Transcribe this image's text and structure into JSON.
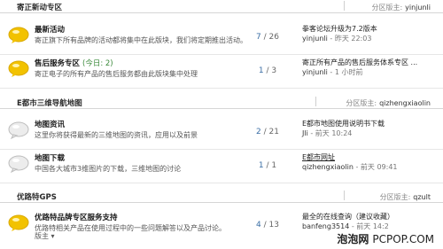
{
  "sections": [
    {
      "title": "寄正新动专区",
      "moderator_label": "分区版主:",
      "moderator": "yinjunli",
      "forums": [
        {
          "name": "最新活动",
          "today": "",
          "description": "寄正旗下所有品牌的活动都将集中在此版块，我们将定期推出活动。",
          "moderator_line": "",
          "stats": "7 / 26",
          "topics": "7",
          "posts": "26",
          "last_title": "拳客论坛升级为7.2版本",
          "last_user": "yinjunli",
          "last_time": "- 昨天 22:03",
          "icon": "new-posts-bubble-icon"
        },
        {
          "name": "售后服务专区",
          "today": "(今日: 2)",
          "description": "寄正电子的所有产品的售后服务都由此版块集中处理",
          "moderator_line": "",
          "stats": "1 / 3",
          "topics": "1",
          "posts": "3",
          "last_title": "寄正所有产品的售后服务体系专区 ...",
          "last_user": "yinjunli",
          "last_time": "- 1 小时前",
          "icon": "new-posts-bubble-icon"
        }
      ]
    },
    {
      "title": "E都市三维导航地图",
      "moderator_label": "分区版主:",
      "moderator": "qizhengxiaolin",
      "forums": [
        {
          "name": "地图资讯",
          "today": "",
          "description": "这里你将获得最新的三维地图的资讯，应用以及前景",
          "moderator_line": "",
          "stats": "2 / 21",
          "topics": "2",
          "posts": "21",
          "last_title": "E都市地图使用说明书下载",
          "last_user": "Jli",
          "last_time": "- 前天 10:24",
          "icon": "no-new-posts-bubble-icon"
        },
        {
          "name": "地图下载",
          "today": "",
          "description": "中国各大城市3维图片的下载，三维地图的讨论",
          "moderator_line": "",
          "stats": "1 / 1",
          "topics": "1",
          "posts": "1",
          "last_title": "E都市网址",
          "last_user": "qizhengxiaolin",
          "last_time": "- 前天 09:41",
          "icon": "no-new-posts-bubble-icon"
        }
      ]
    },
    {
      "title": "优路特GPS",
      "moderator_label": "分区版主:",
      "moderator": "qzult",
      "forums": [
        {
          "name": "优路特品牌专区服务支持",
          "today": "",
          "description": "优路特相关产品在使用过程中的一些问题解答以及产品讨论。",
          "moderator_line": "版主 ▾",
          "stats": "4 / 13",
          "topics": "4",
          "posts": "13",
          "last_title": "最全的在线查询（建议收藏）",
          "last_user": "banfeng3514",
          "last_time": "- 前天 14:2",
          "icon": "new-posts-bubble-icon"
        }
      ]
    }
  ],
  "watermark": {
    "brand": "泡泡网",
    "url": "PCPOP.COM"
  },
  "colors": {
    "new_bubble": "#f2c200",
    "old_bubble": "#d9d9d9",
    "topics_link": "#3a6ea5"
  }
}
